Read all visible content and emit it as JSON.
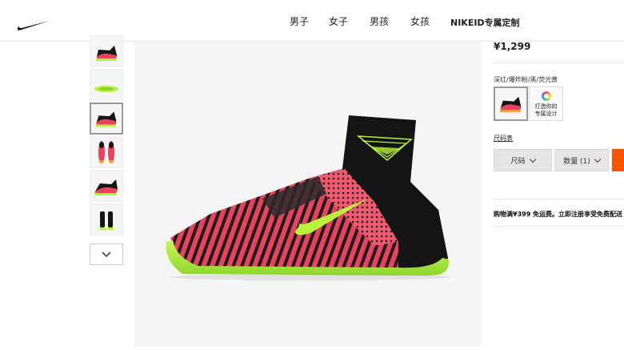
{
  "header": {
    "logo_icon": "nike-swoosh-icon",
    "nav": [
      {
        "label": "男子"
      },
      {
        "label": "女子"
      },
      {
        "label": "男孩"
      },
      {
        "label": "女孩"
      },
      {
        "label": "NIKEID专属定制"
      }
    ]
  },
  "gallery": {
    "thumbnails": [
      {
        "icon": "shoe-side-thumbnail"
      },
      {
        "icon": "shoe-sole-thumbnail"
      },
      {
        "icon": "shoe-side-thumbnail",
        "selected": true
      },
      {
        "icon": "shoe-top-thumbnail"
      },
      {
        "icon": "shoe-angle-thumbnail"
      },
      {
        "icon": "shoe-back-thumbnail"
      }
    ],
    "scroll_down_icon": "chevron-down-icon"
  },
  "product": {
    "price": "¥1,299",
    "color_label": "深红/爆炸粉/黑/荧光黄",
    "custom_label_line1": "打造你的",
    "custom_label_line2": "专属设计",
    "size_chart_link": "尺码表",
    "size_select": "尺码",
    "qty_select": "数量 (1)",
    "shipping_note": "购物满¥399 免运费。立即注册享受免费配送"
  },
  "colors": {
    "accent_orange": "#fa5400",
    "shoe_pink": "#e8425d",
    "shoe_black": "#151515",
    "volt": "#b8f23a"
  }
}
